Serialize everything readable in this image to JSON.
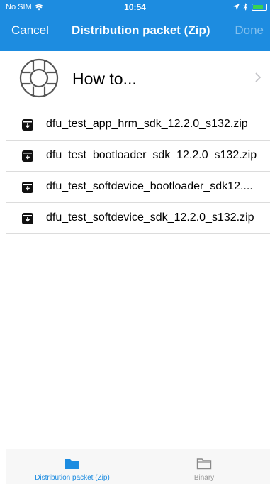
{
  "status_bar": {
    "carrier": "No SIM",
    "time": "10:54",
    "battery_level": 0.8
  },
  "nav": {
    "cancel_label": "Cancel",
    "title": "Distribution packet (Zip)",
    "done_label": "Done"
  },
  "help": {
    "label": "How to...",
    "icon": "lifebuoy-icon"
  },
  "files": [
    {
      "name": "dfu_test_app_hrm_sdk_12.2.0_s132.zip"
    },
    {
      "name": "dfu_test_bootloader_sdk_12.2.0_s132.zip"
    },
    {
      "name": "dfu_test_softdevice_bootloader_sdk12...."
    },
    {
      "name": "dfu_test_softdevice_sdk_12.2.0_s132.zip"
    }
  ],
  "tabs": [
    {
      "label": "Distribution packet (Zip)",
      "active": true,
      "icon": "folder-filled-icon"
    },
    {
      "label": "Binary",
      "active": false,
      "icon": "folder-outline-icon"
    }
  ],
  "colors": {
    "accent": "#1d8ce0",
    "inactive": "#9a9a9a",
    "separator": "#dcdcdc"
  }
}
